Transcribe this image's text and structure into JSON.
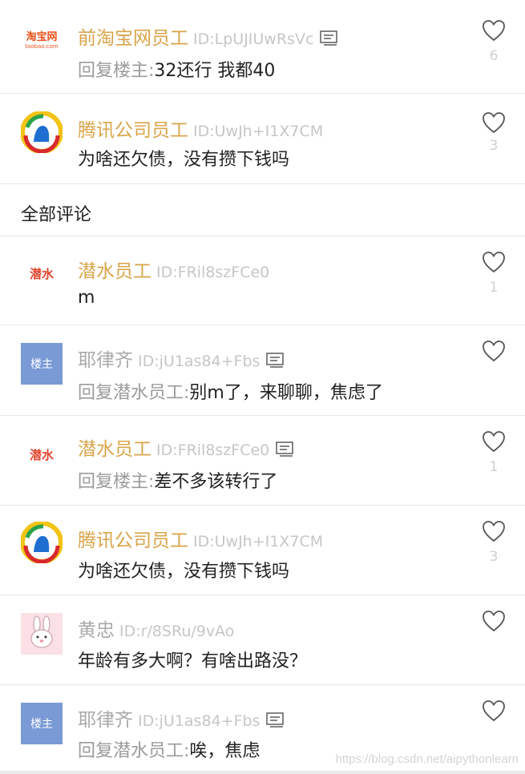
{
  "comments": [
    {
      "name": "前淘宝网员工",
      "uid": "ID:LpUJIUwRsVc",
      "reply_prefix": "回复楼主:",
      "text": "32还行 我都40",
      "likes": "6",
      "avatar_label": "淘宝网",
      "avatar_sub": "taobao.com"
    },
    {
      "name": "腾讯公司员工",
      "uid": "ID:UwJh+I1X7CM",
      "text": "为啥还欠债，没有攒下钱吗",
      "likes": "3"
    }
  ],
  "section_title": "全部评论",
  "all_comments": [
    {
      "name": "潜水员工",
      "uid": "ID:FRil8szFCe0",
      "text": "m",
      "likes": "1",
      "avatar_label": "潜水"
    },
    {
      "name": "耶律齐",
      "uid": "ID:jU1as84+Fbs",
      "reply_prefix": "回复潜水员工:",
      "text": "别m了，来聊聊，焦虑了",
      "avatar_label": "楼主"
    },
    {
      "name": "潜水员工",
      "uid": "ID:FRil8szFCe0",
      "reply_prefix": "回复楼主:",
      "text": "差不多该转行了",
      "likes": "1",
      "avatar_label": "潜水"
    },
    {
      "name": "腾讯公司员工",
      "uid": "ID:UwJh+I1X7CM",
      "text": "为啥还欠债，没有攒下钱吗",
      "likes": "3"
    },
    {
      "name": "黄忠",
      "uid": "ID:r/8SRu/9vAo",
      "text": "年龄有多大啊？有啥出路没？"
    },
    {
      "name": "耶律齐",
      "uid": "ID:jU1as84+Fbs",
      "reply_prefix": "回复潜水员工:",
      "text": "唉，焦虑",
      "avatar_label": "楼主"
    }
  ],
  "watermark": "https://blog.csdn.net/aipythonlearn",
  "colors": {
    "company_name": "#d9a44a",
    "anon_name": "#a9a9a9",
    "uid": "#c6c6c6",
    "like_count": "#cfcfcf",
    "louzhu_avatar": "#7a9ad6"
  }
}
